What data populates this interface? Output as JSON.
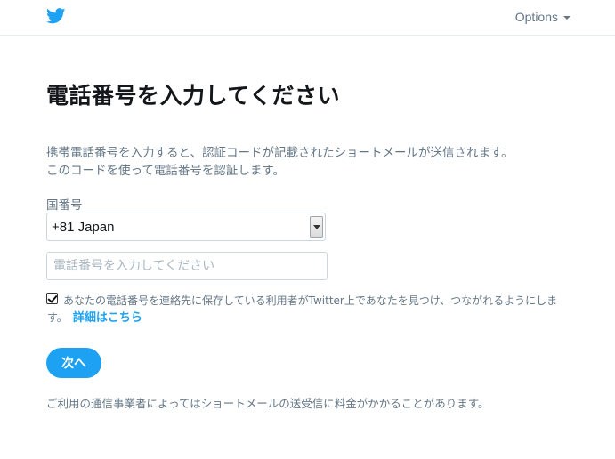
{
  "header": {
    "logo_icon": "twitter-bird-icon",
    "brand_color": "#1da1f2",
    "options_label": "Options"
  },
  "main": {
    "title": "電話番号を入力してください",
    "description_line1": "携帯電話番号を入力すると、認証コードが記載されたショートメールが送信されます。",
    "description_line2": "このコードを使って電話番号を認証します。",
    "country_label": "国番号",
    "country_selected": "+81 Japan",
    "phone_placeholder": "電話番号を入力してください",
    "phone_value": "",
    "consent_checked": true,
    "consent_line1": "あなたの電話番号を連絡先に保存している利用者がTwitter上であなたを見つけ、つながれるようにしま",
    "consent_line2": "す。",
    "learn_more_link": "詳細はこちら",
    "next_button": "次へ",
    "footer_note": "ご利用の通信事業者によってはショートメールの送受信に料金がかかることがあります。"
  }
}
